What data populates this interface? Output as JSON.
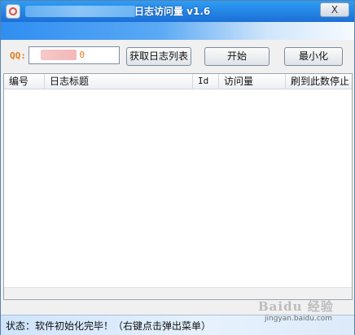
{
  "window": {
    "title": "日志访问量 v1.6",
    "close_label": "X"
  },
  "toolbar": {
    "qq_label": "QQ:",
    "qq_value": "0",
    "get_list_label": "获取日志列表",
    "start_label": "开始",
    "minimize_label": "最小化"
  },
  "table": {
    "columns": [
      "编号",
      "日志标题",
      "Id",
      "访问量",
      "刷到此数停止"
    ]
  },
  "status": {
    "text": "状态：软件初始化完毕！（右键点击弹出菜单）"
  },
  "watermark": {
    "main": "Baidu 经验",
    "sub": "jingyan.baidu.com"
  },
  "colors": {
    "title_blue": "#1b6fd6",
    "qq_label": "#e07c1f"
  },
  "icons": {
    "app": "app-icon",
    "close": "close-icon"
  }
}
